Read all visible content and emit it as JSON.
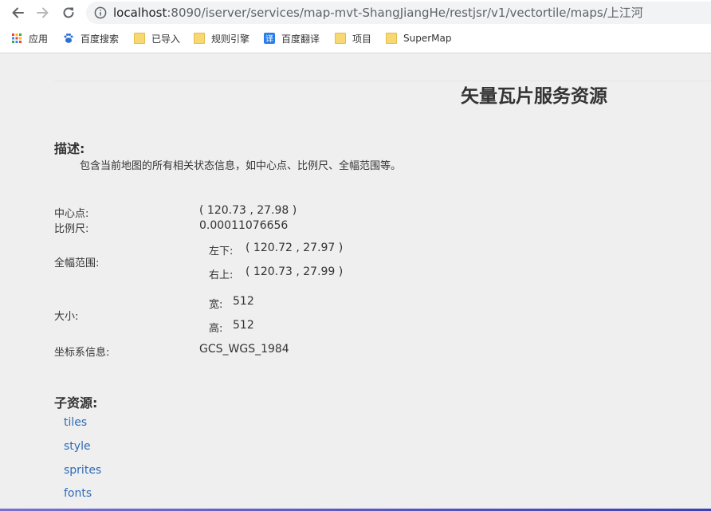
{
  "browser": {
    "url_host": "localhost",
    "url_rest": ":8090/iserver/services/map-mvt-ShangJiangHe/restjsr/v1/vectortile/maps/上江河",
    "bookmarks": [
      {
        "label": "应用",
        "icon": "apps-grid-icon"
      },
      {
        "label": "百度搜索",
        "icon": "baidu-paw-icon"
      },
      {
        "label": "已导入",
        "icon": "folder-icon"
      },
      {
        "label": "规则引擎",
        "icon": "folder-icon"
      },
      {
        "label": "百度翻译",
        "icon": "translate-icon"
      },
      {
        "label": "项目",
        "icon": "folder-icon"
      },
      {
        "label": "SuperMap",
        "icon": "folder-icon"
      }
    ]
  },
  "page": {
    "title": "矢量瓦片服务资源",
    "description_heading": "描述:",
    "description": "包含当前地图的所有相关状态信息，如中心点、比例尺、全幅范围等。",
    "center_label": "中心点:",
    "center_value": "( 120.73 , 27.98 )",
    "scale_label": "比例尺:",
    "scale_value": "0.00011076656",
    "bounds_label": "全幅范围:",
    "bounds_lower_left_label": "左下:",
    "bounds_lower_left_value": "( 120.72 , 27.97 )",
    "bounds_upper_right_label": "右上:",
    "bounds_upper_right_value": "( 120.73 , 27.99 )",
    "size_label": "大小:",
    "size_width_label": "宽:",
    "size_width_value": "512",
    "size_height_label": "高:",
    "size_height_value": "512",
    "crs_label": "坐标系信息:",
    "crs_value": "GCS_WGS_1984",
    "child_heading": "子资源:",
    "child_links": [
      "tiles",
      "style",
      "sprites",
      "fonts"
    ]
  },
  "colors": {
    "link": "#2f6bb8",
    "background": "#efefef"
  }
}
